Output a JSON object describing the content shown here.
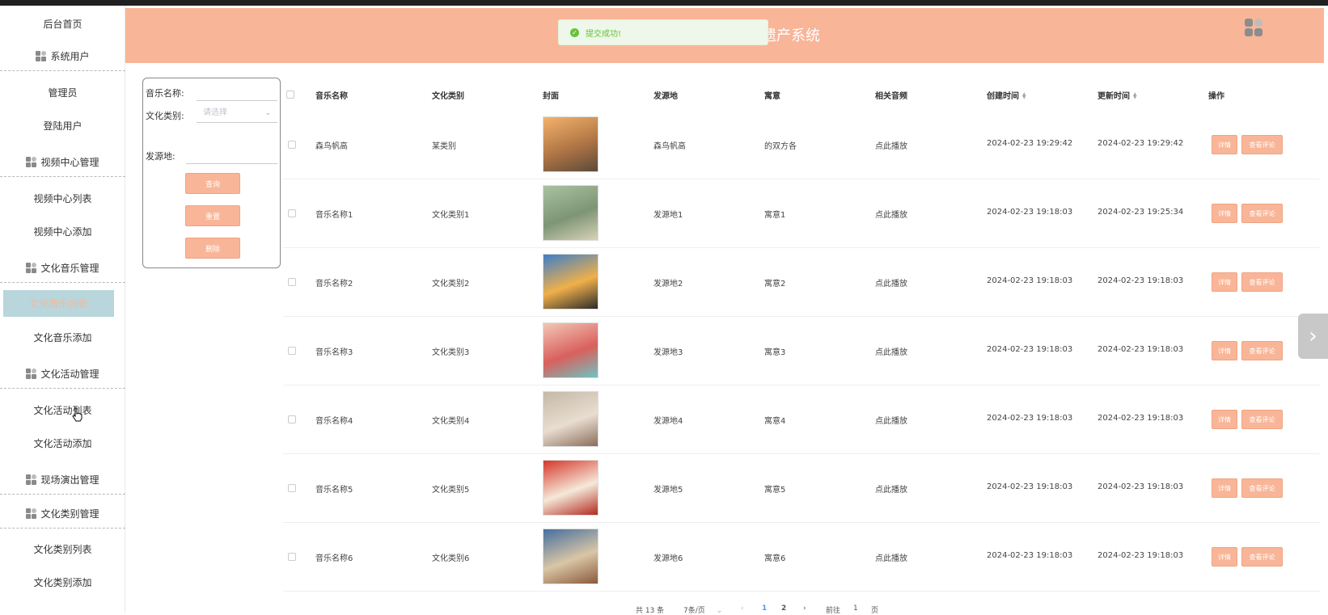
{
  "sidebar": {
    "home": "后台首页",
    "groups": [
      {
        "label": "系统用户",
        "items": [
          "管理员",
          "登陆用户"
        ]
      },
      {
        "label": "视频中心管理",
        "items": [
          "视频中心列表",
          "视频中心添加"
        ]
      },
      {
        "label": "文化音乐管理",
        "items": [
          "文化音乐列表",
          "文化音乐添加"
        ]
      },
      {
        "label": "文化活动管理",
        "items": [
          "文化活动列表",
          "文化活动添加"
        ]
      },
      {
        "label": "现场演出管理",
        "items": []
      },
      {
        "label": "文化类别管理",
        "items": [
          "文化类别列表",
          "文化类别添加"
        ]
      }
    ]
  },
  "header": {
    "title_visible": "遗产系统",
    "toast": "提交成功!"
  },
  "search": {
    "name_label": "音乐名称:",
    "category_label": "文化类别:",
    "category_placeholder": "请选择",
    "origin_label": "发源地:",
    "query_button": "查询",
    "reset_button": "重置",
    "delete_button": "删除"
  },
  "table": {
    "headers": [
      "音乐名称",
      "文化类别",
      "封面",
      "发源地",
      "寓意",
      "相关音频",
      "创建时间",
      "更新时间",
      "操作"
    ],
    "rows": [
      {
        "name": "森鸟帆高",
        "category": "某类别",
        "origin": "森鸟帆高",
        "meaning": "的双方各",
        "audio": "点此播放",
        "created": "2024-02-23 19:29:42",
        "updated": "2024-02-23 19:29:42"
      },
      {
        "name": "音乐名称1",
        "category": "文化类别1",
        "origin": "发源地1",
        "meaning": "寓意1",
        "audio": "点此播放",
        "created": "2024-02-23 19:18:03",
        "updated": "2024-02-23 19:25:34"
      },
      {
        "name": "音乐名称2",
        "category": "文化类别2",
        "origin": "发源地2",
        "meaning": "寓意2",
        "audio": "点此播放",
        "created": "2024-02-23 19:18:03",
        "updated": "2024-02-23 19:18:03"
      },
      {
        "name": "音乐名称3",
        "category": "文化类别3",
        "origin": "发源地3",
        "meaning": "寓意3",
        "audio": "点此播放",
        "created": "2024-02-23 19:18:03",
        "updated": "2024-02-23 19:18:03"
      },
      {
        "name": "音乐名称4",
        "category": "文化类别4",
        "origin": "发源地4",
        "meaning": "寓意4",
        "audio": "点此播放",
        "created": "2024-02-23 19:18:03",
        "updated": "2024-02-23 19:18:03"
      },
      {
        "name": "音乐名称5",
        "category": "文化类别5",
        "origin": "发源地5",
        "meaning": "寓意5",
        "audio": "点此播放",
        "created": "2024-02-23 19:18:03",
        "updated": "2024-02-23 19:18:03"
      },
      {
        "name": "音乐名称6",
        "category": "文化类别6",
        "origin": "发源地6",
        "meaning": "寓意6",
        "audio": "点此播放",
        "created": "2024-02-23 19:18:03",
        "updated": "2024-02-23 19:18:03"
      }
    ],
    "detail_button": "详情",
    "comment_button": "查看评论"
  },
  "pagination": {
    "total": "共 13 条",
    "page_size": "7条/页",
    "prev_icon": "‹",
    "pages": [
      "1",
      "2"
    ],
    "next_icon": "›",
    "goto_label": "前往",
    "goto_value": "1",
    "page_unit": "页"
  },
  "colors": {
    "accent": "#f9b597",
    "active_bg": "#b8d6dc",
    "success": "#67c23a"
  }
}
